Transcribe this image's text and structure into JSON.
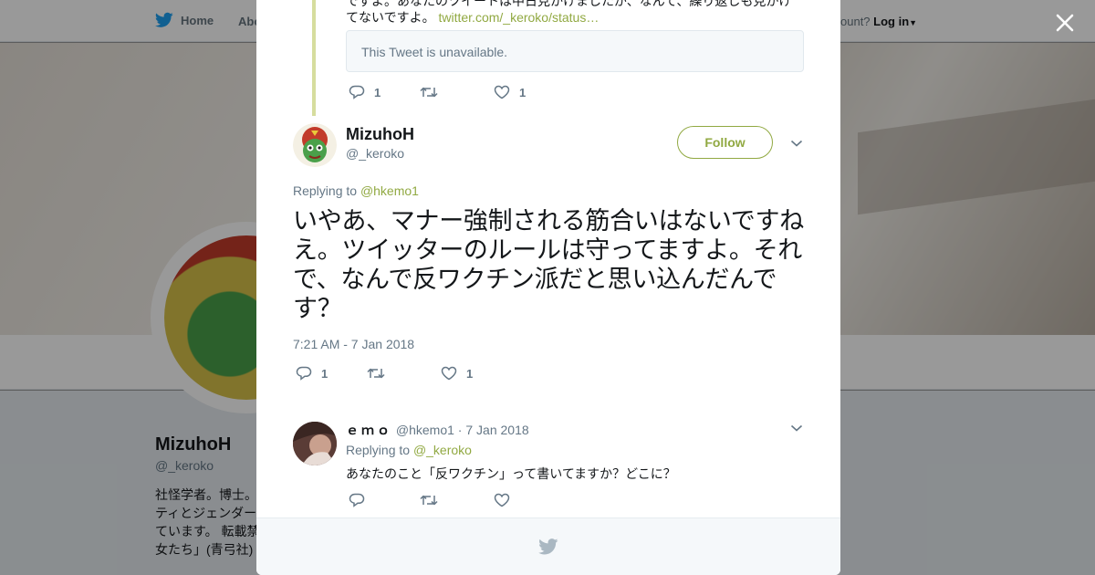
{
  "background": {
    "nav": {
      "home": "Home",
      "about": "Abo",
      "account_prompt": "ccount?",
      "login": "Log in"
    },
    "profile": {
      "name": "MizuhoH",
      "handle": "@_keroko",
      "bio": "社怪学者。博士。ティとジェンダーています。 転載禁女たち」(青弓社)"
    }
  },
  "quoted": {
    "text_visible": "でずよ。あなたのツイートは中日見かけましたが、なんて、繰り返しも見かけてないですよ。",
    "link": "twitter.com/_keroko/status…",
    "unavailable": "This Tweet is unavailable.",
    "reply_count": "1",
    "retweet_count": "",
    "like_count": "1"
  },
  "main_tweet": {
    "name": "MizuhoH",
    "handle": "@_keroko",
    "follow_label": "Follow",
    "replying_prefix": "Replying to ",
    "replying_to": "@hkemo1",
    "text": "いやあ、マナー強制される筋合いはないですねえ。ツイッターのルールは守ってますよ。それで、なんで反ワクチン派だと思い込んだんです？",
    "timestamp": "7:21 AM - 7 Jan 2018",
    "reply_count": "1",
    "retweet_count": "",
    "like_count": "1"
  },
  "reply_tweet": {
    "name": "ｅｍｏ",
    "handle": "@hkemo1",
    "separator": " · ",
    "date": "7 Jan 2018",
    "replying_prefix": "Replying to ",
    "replying_to": "@_keroko",
    "text": "あなたのこと「反ワクチン」って書いてますか？どこに？"
  },
  "colors": {
    "accent": "#91a942",
    "thread_line": "#d6dd9e",
    "text": "#14171a",
    "muted": "#657786",
    "twitter_blue": "#1da1f2"
  }
}
